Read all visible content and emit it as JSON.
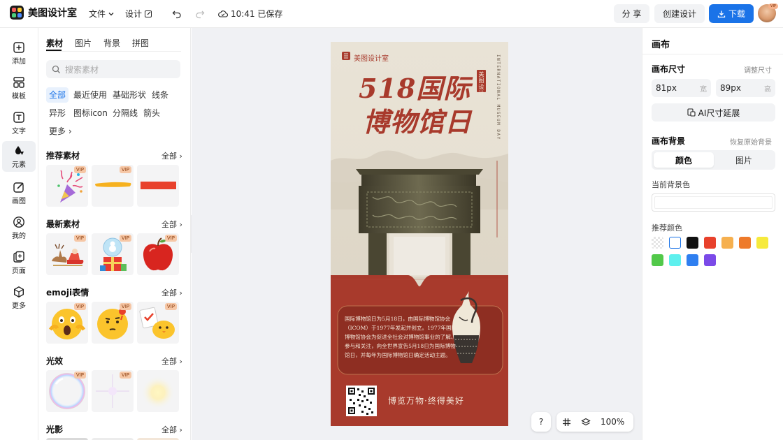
{
  "app": {
    "name": "美图设计室"
  },
  "topbar": {
    "file_label": "文件",
    "design_label": "设计",
    "save_status": "10:41 已保存",
    "share_label": "分 享",
    "create_label": "创建设计",
    "download_label": "下载",
    "vip_badge": "VIP"
  },
  "rail": {
    "items": [
      {
        "label": "添加",
        "icon": "plus-square-icon"
      },
      {
        "label": "模板",
        "icon": "template-icon"
      },
      {
        "label": "文字",
        "icon": "text-icon"
      },
      {
        "label": "元素",
        "icon": "shapes-icon"
      },
      {
        "label": "画图",
        "icon": "draw-icon"
      },
      {
        "label": "我的",
        "icon": "user-icon"
      },
      {
        "label": "页面",
        "icon": "page-add-icon"
      },
      {
        "label": "更多",
        "icon": "cube-icon"
      }
    ]
  },
  "panel": {
    "tabs": [
      "素材",
      "图片",
      "背景",
      "拼图"
    ],
    "search_placeholder": "搜索素材",
    "chips": [
      "全部",
      "最近使用",
      "基础形状",
      "线条",
      "异形",
      "图标icon",
      "分隔线",
      "箭头",
      "更多"
    ],
    "all_label": "全部",
    "vip": "VIP",
    "sections": [
      "推荐素材",
      "最新素材",
      "emoji表情",
      "光效",
      "光影"
    ]
  },
  "poster": {
    "brand": "美图设计室",
    "title_line1": "518国际",
    "title_line2": "博物馆日",
    "seal": "美图设计",
    "side_text": "INTERNATIONAL MUSEUM DAY",
    "body": "国际博物馆日为5月18日，由国际博物馆协会（ICOM）于1977年发起并创立。1977年国际博物馆协会为促进全社会对博物馆事业的了解、参与和关注，向全世界宣告5月18日为国际博物馆日，并每年为国际博物馆日确定活动主题。",
    "slogan": "博览万物·终得美好"
  },
  "bottom": {
    "help": "?",
    "zoom": "100%"
  },
  "right": {
    "title": "画布",
    "size_label": "画布尺寸",
    "adjust_label": "调整尺寸",
    "width_value": "81px",
    "width_unit": "宽",
    "height_value": "89px",
    "height_unit": "高",
    "ai_label": "AI尺寸延展",
    "bg_label": "画布背景",
    "restore_label": "恢复原始背景",
    "seg_color": "颜色",
    "seg_image": "图片",
    "current_bg_label": "当前背景色",
    "recommend_label": "推荐颜色",
    "swatches": [
      "transparent",
      "#ffffff",
      "#111111",
      "#e8412c",
      "#f6b04f",
      "#ee7a2a",
      "#f6ea3c",
      "#52c94a",
      "#5ef0ee",
      "#2f7ff0",
      "#7b4ae8"
    ]
  }
}
